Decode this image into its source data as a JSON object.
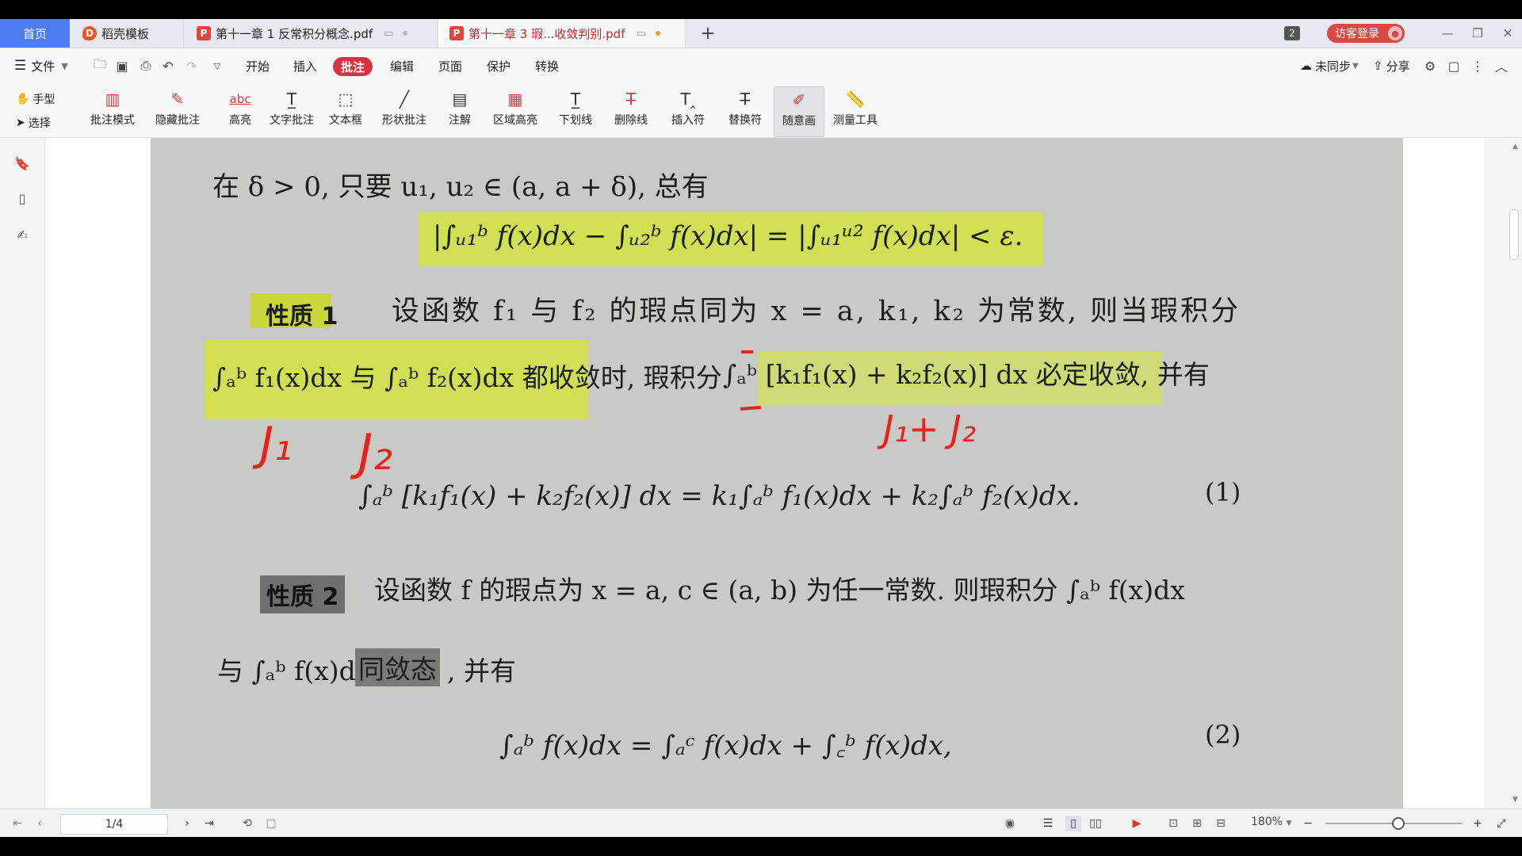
{
  "tabs": {
    "home": "首页",
    "template": "稻壳模板",
    "doc1": "第十一章 1 反常积分概念.pdf",
    "doc2": "第十一章 3 瑕...收敛判别.pdf",
    "new_tab": "+",
    "count_badge": "2",
    "login": "访客登录"
  },
  "menu": {
    "file": "文件",
    "items": [
      "开始",
      "插入",
      "批注",
      "编辑",
      "页面",
      "保护",
      "转换"
    ],
    "active": "批注",
    "sync": "未同步",
    "share": "分享"
  },
  "ribbon": {
    "hand": "手型",
    "select": "选择",
    "tools": [
      "批注模式",
      "隐藏批注",
      "高亮",
      "文字批注",
      "文本框",
      "形状批注",
      "注解",
      "区域高亮",
      "下划线",
      "删除线",
      "插入符",
      "替换符",
      "随意画",
      "测量工具"
    ],
    "selected_tool": "随意画"
  },
  "document": {
    "line1": "在 δ > 0, 只要 u₁, u₂ ∈ (a, a + δ), 总有",
    "eq1": "|∫ᵤ₁ᵇ f(x)dx − ∫ᵤ₂ᵇ f(x)dx| = |∫ᵤ₁ᵘ² f(x)dx| < ε.",
    "prop1_label": "性质 1",
    "prop1_text": "设函数 f₁ 与 f₂ 的瑕点同为 x = a, k₁, k₂ 为常数, 则当瑕积分",
    "prop1_line2a": "∫ₐᵇ f₁(x)dx 与 ∫ₐᵇ f₂(x)dx 都收敛时, 瑕积分",
    "prop1_line2b": "∫ₐᵇ [k₁f₁(x) + k₂f₂(x)] dx 必定收敛, 并有",
    "eq2": "∫ₐᵇ [k₁f₁(x) + k₂f₂(x)] dx = k₁∫ₐᵇ f₁(x)dx + k₂∫ₐᵇ f₂(x)dx.",
    "eq2_num": "(1)",
    "prop2_label": "性质 2",
    "prop2_text": "设函数 f 的瑕点为 x = a, c ∈ (a, b) 为任一常数. 则瑕积分 ∫ₐᵇ f(x)dx",
    "prop2_line2a": "与 ∫ₐᵇ f(x)dx",
    "prop2_line2b": "同敛态",
    "prop2_line2c": ", 并有",
    "eq3": "∫ₐᵇ f(x)dx = ∫ₐᶜ f(x)dx + ∫꜀ᵇ f(x)dx,",
    "eq3_num": "(2)",
    "ink": {
      "j1": "J₁",
      "j2": "J₂",
      "sum": "J₁+ J₂"
    }
  },
  "status": {
    "page": "1/4",
    "zoom": "180%"
  },
  "colors": {
    "accent_blue": "#4d7cf4",
    "active_red": "#d8333f",
    "highlight": "#d4e634",
    "ink_red": "#e8211c"
  }
}
